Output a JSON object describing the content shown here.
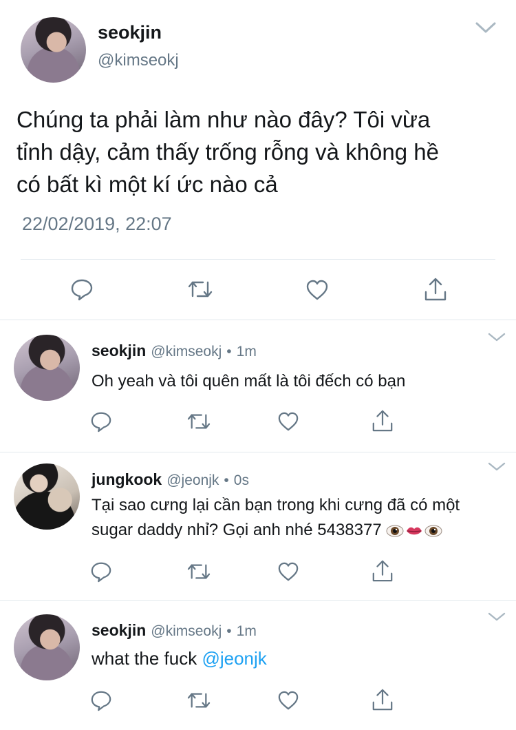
{
  "main_tweet": {
    "display_name": "seokjin",
    "handle": "@kimseokj",
    "text_lines": [
      "Chúng ta phải làm như nào đây? Tôi vừa",
      "tỉnh dậy, cảm thấy trống rỗng và không hề",
      "có bất kì một kí ức nào cả"
    ],
    "timestamp": "22/02/2019, 22:07",
    "actions": {
      "reply": "reply-icon",
      "retweet": "retweet-icon",
      "like": "heart-icon",
      "share": "share-icon"
    }
  },
  "replies": [
    {
      "display_name": "seokjin",
      "handle": "@kimseokj",
      "separator": "•",
      "time": "1m",
      "text": "Oh yeah và tôi quên mất là tôi đếch có bạn"
    },
    {
      "display_name": "jungkook",
      "handle": "@jeonjk",
      "separator": "•",
      "time": "0s",
      "text_lines": [
        "Tại sao cưng lại cần bạn trong khi cưng đã có một",
        "sugar daddy nhỉ? Gọi anh nhé 5438377"
      ],
      "emoji": [
        "eye",
        "lips",
        "eye"
      ]
    },
    {
      "display_name": "seokjin",
      "handle": "@kimseokj",
      "separator": "•",
      "time": "1m",
      "text": "what the fuck",
      "mention": "@jeonjk"
    }
  ],
  "colors": {
    "text": "#14171a",
    "secondary": "#657786",
    "link": "#1da1f2",
    "divider": "#e1e8ed"
  }
}
